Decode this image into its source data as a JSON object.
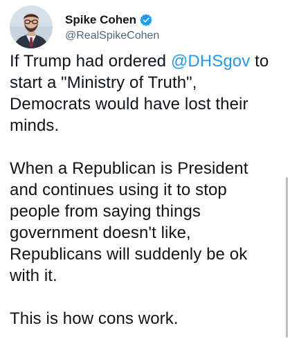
{
  "author": {
    "display_name": "Spike Cohen",
    "handle": "@RealSpikeCohen",
    "verified": true,
    "avatar_icon": "profile-photo",
    "verified_icon": "verified-badge-icon",
    "verified_color": "#1d9bf0"
  },
  "tweet": {
    "p1_l1_a": "If Trump had ordered ",
    "p1_l1_mention": "@DHSgov",
    "p1_l1_b": " to",
    "p1_l2": "start a \"Ministry of Truth\",",
    "p1_l3": "Democrats would have lost their",
    "p1_l4": "minds.",
    "p2_l1": "When a Republican is President",
    "p2_l2": "and continues using it to stop",
    "p2_l3": "people from saying things",
    "p2_l4": "government doesn't like,",
    "p2_l5": "Republicans will suddenly be ok",
    "p2_l6": "with it.",
    "p3_l1": "This is how cons work."
  },
  "colors": {
    "text": "#0f1419",
    "secondary": "#536471",
    "link": "#1d9bf0",
    "background": "#ffffff"
  }
}
